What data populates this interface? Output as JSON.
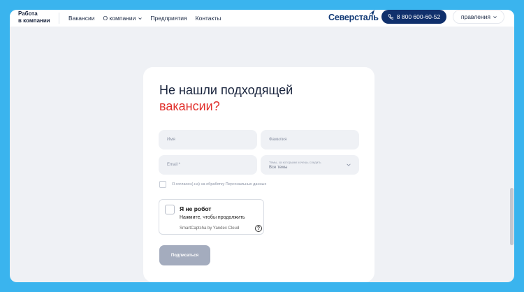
{
  "header": {
    "brand_line1": "Работа",
    "brand_line2": "в компании",
    "nav": [
      {
        "label": "Вакансии"
      },
      {
        "label": "О компании"
      },
      {
        "label": "Предприятия"
      },
      {
        "label": "Контакты"
      }
    ],
    "logo": "Северсталь",
    "phone": "8 800 600-60-52",
    "directions_label": "правления"
  },
  "form": {
    "title_line1": "Не нашли подходящей",
    "title_line2": "вакансии?",
    "first_name_placeholder": "Имя",
    "last_name_placeholder": "Фамилия",
    "email_placeholder": "Email *",
    "topics_label": "Темы, за которыми хочешь следить",
    "topics_value": "Все темы",
    "consent_text": "Я согласен(-на) на обработку Персональных данных",
    "captcha": {
      "title": "Я не робот",
      "subtitle": "Нажмите, чтобы продолжить",
      "brand": "SmartCaptcha by Yandex Cloud",
      "help": "?"
    },
    "submit_label": "Подписаться"
  },
  "colors": {
    "accent_red": "#e1302c",
    "brand_navy": "#10306c",
    "frame_blue": "#3ab4ee",
    "disabled_button": "#a4acbe"
  }
}
